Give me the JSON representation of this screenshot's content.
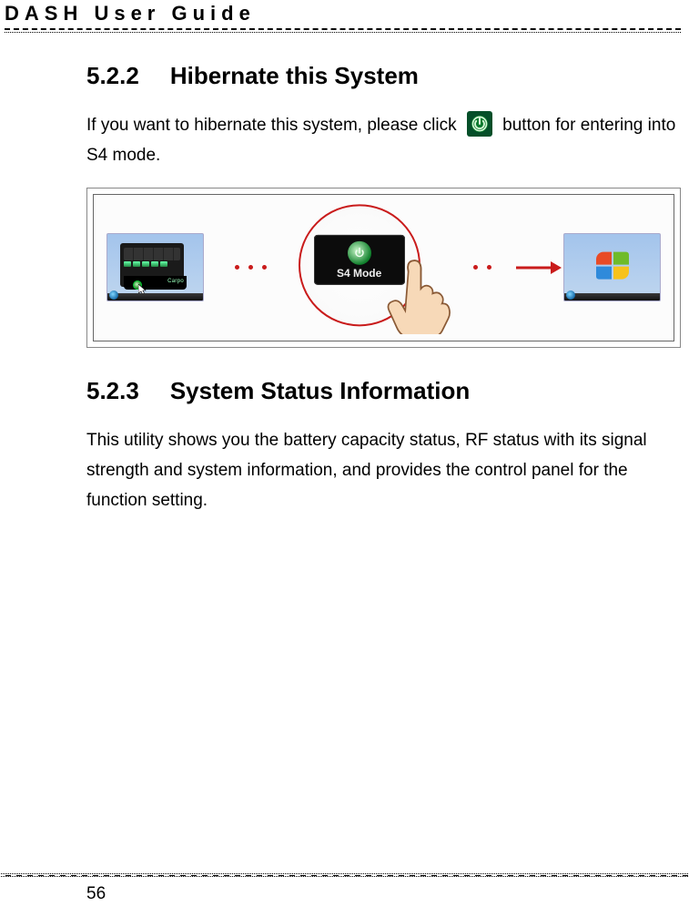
{
  "header": {
    "title": "DASH User Guide"
  },
  "sections": {
    "hibernate": {
      "number": "5.2.2",
      "title": "Hibernate this System",
      "para_a": "If you want to hibernate this system, please click",
      "para_b": "button for entering into S4 mode."
    },
    "status": {
      "number": "5.2.3",
      "title": "System Status Information",
      "para": "This utility shows you the battery capacity status, RF status with its signal strength and system information, and provides the control panel for the function setting."
    }
  },
  "figure": {
    "left_thumb_caption": "Carpo",
    "center_tile_label": "S4 Mode"
  },
  "page_number": "56"
}
